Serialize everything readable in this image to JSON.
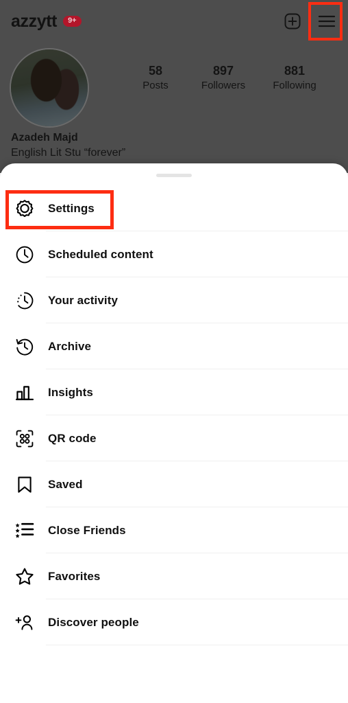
{
  "profile": {
    "username": "azzytt",
    "notification_badge": "9+",
    "create_icon": "plus-square-icon",
    "menu_icon": "hamburger-menu-icon",
    "avatar_icon": "profile-avatar",
    "stats": [
      {
        "value": "58",
        "label": "Posts"
      },
      {
        "value": "897",
        "label": "Followers"
      },
      {
        "value": "881",
        "label": "Following"
      }
    ],
    "display_name": "Azadeh Majd",
    "bio": "English Lit Stu “forever”"
  },
  "sheet": {
    "grabber": "drag-handle",
    "items": [
      {
        "label": "Settings",
        "icon": "gear-icon"
      },
      {
        "label": "Scheduled content",
        "icon": "clock-icon"
      },
      {
        "label": "Your activity",
        "icon": "activity-clock-icon"
      },
      {
        "label": "Archive",
        "icon": "history-clock-icon"
      },
      {
        "label": "Insights",
        "icon": "bar-chart-icon"
      },
      {
        "label": "QR code",
        "icon": "qr-code-icon"
      },
      {
        "label": "Saved",
        "icon": "bookmark-icon"
      },
      {
        "label": "Close Friends",
        "icon": "close-friends-list-icon"
      },
      {
        "label": "Favorites",
        "icon": "star-icon"
      },
      {
        "label": "Discover people",
        "icon": "add-person-icon"
      }
    ]
  },
  "highlights": {
    "color": "#fd2d12",
    "targets": [
      "hamburger-menu-icon",
      "Settings"
    ]
  },
  "colors": {
    "dim_overlay": "#4d4d4d",
    "sheet_background": "#ffffff",
    "badge_red": "#b3162a",
    "highlight_red": "#fd2d12",
    "divider": "#efefef",
    "text": "#101010"
  }
}
